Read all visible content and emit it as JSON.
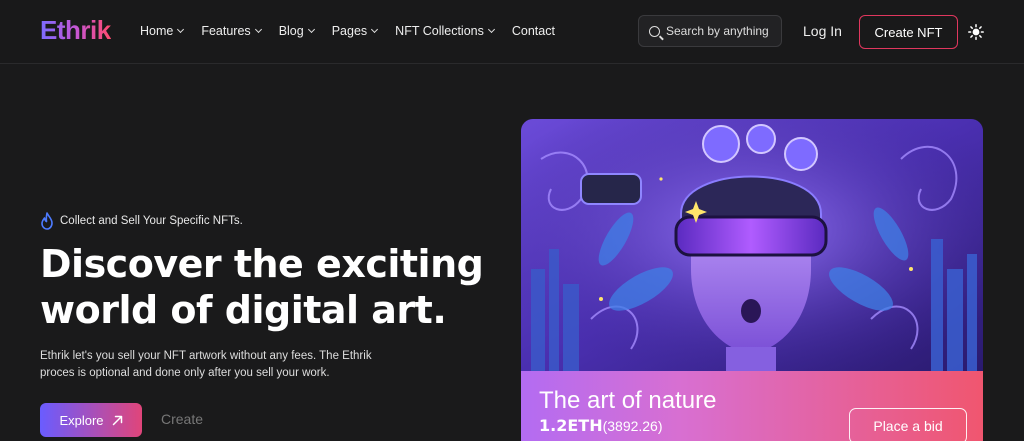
{
  "brand": {
    "logo": "Ethrik"
  },
  "nav": {
    "items": [
      {
        "label": "Home",
        "has_dropdown": true
      },
      {
        "label": "Features",
        "has_dropdown": true
      },
      {
        "label": "Blog",
        "has_dropdown": true
      },
      {
        "label": "Pages",
        "has_dropdown": true
      },
      {
        "label": "NFT Collections",
        "has_dropdown": true
      },
      {
        "label": "Contact",
        "has_dropdown": false
      }
    ],
    "search_placeholder": "Search by anything",
    "login_label": "Log In",
    "create_label": "Create NFT",
    "theme_icon": "sun-icon"
  },
  "hero": {
    "tag": "Collect and Sell Your Specific NFTs.",
    "headline": "Discover the exciting world of digital art.",
    "description": "Ethrik let's you sell your NFT artwork without any fees. The Ethrik proces is optional and done only after you sell your work.",
    "explore_label": "Explore",
    "create_label": "Create"
  },
  "card": {
    "title": "The art of nature",
    "price": "1.2ETH",
    "price_usd": "(3892.26)",
    "bid_label": "Place a bid"
  },
  "colors": {
    "background": "#1a1a1b",
    "accent_start": "#6a5cff",
    "accent_end": "#e0457a",
    "create_border": "#e0375e"
  }
}
